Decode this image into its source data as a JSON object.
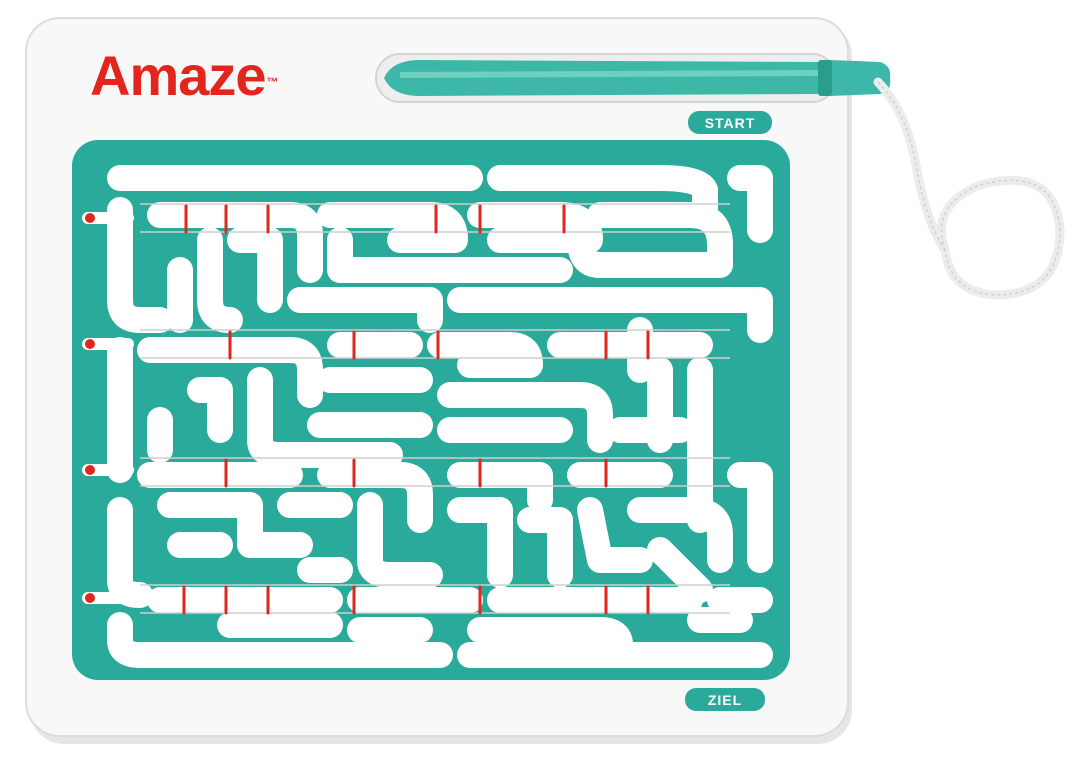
{
  "product": {
    "brand": "Amaze",
    "trademark": "™",
    "start_label": "START",
    "goal_label": "ZIEL"
  },
  "colors": {
    "board": "#f7f7f7",
    "board_edge": "#d9d9d9",
    "maze_teal": "#2aaa9a",
    "path_white": "#ffffff",
    "slider_red": "#e2261e",
    "brand_red": "#e2261e",
    "cord": "#f2f2f2"
  },
  "objects": {
    "stylus": "teal stylus pen",
    "cord": "white cord loop",
    "sliders": "red slider markers"
  }
}
